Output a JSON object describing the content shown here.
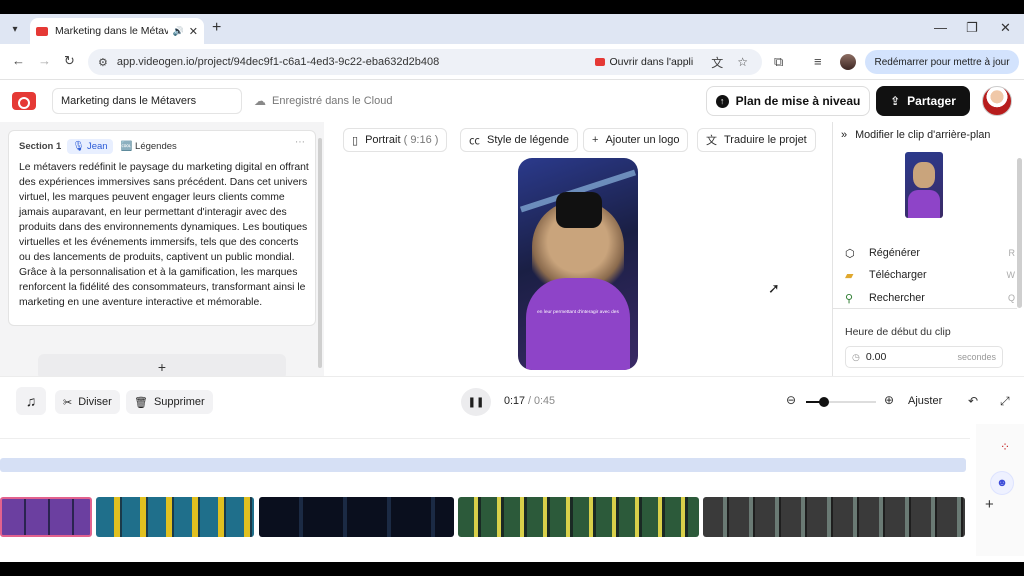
{
  "browser": {
    "tab_title": "Marketing dans le Métavers",
    "url": "app.videogen.io/project/94dec9f1-c6a1-4ed3-9c22-eba632d2b408",
    "open_in_app": "Ouvrir dans l'appli",
    "restart_label": "Redémarrer pour mettre à jour"
  },
  "header": {
    "project_name": "Marketing dans le Métavers",
    "save_status": "Enregistré dans le Cloud",
    "upgrade_label": "Plan de mise à niveau",
    "share_label": "Partager"
  },
  "script": {
    "section_label": "Section 1",
    "voice": "Jean",
    "captions": "Légendes",
    "text": "Le métavers redéfinit le paysage du marketing digital en offrant des expériences immersives sans précédent. Dans cet univers virtuel, les marques peuvent engager leurs clients comme jamais auparavant, en leur permettant d'interagir avec des produits dans des environnements dynamiques. Les boutiques virtuelles et les événements immersifs, tels que des concerts ou des lancements de produits, captivent un public mondial. Grâce à la personnalisation et à la gamification, les marques renforcent la fidélité des consommateurs, transformant ainsi le marketing en une aventure interactive et mémorable.",
    "add_label": "+"
  },
  "toolbar": {
    "portrait": "Portrait",
    "ratio": "( 9:16 )",
    "caption_style": "Style de légende",
    "add_logo": "Ajouter un logo",
    "translate": "Traduire le projet"
  },
  "preview": {
    "caption": "en leur permettant d'interagir avec des"
  },
  "right_panel": {
    "title": "Modifier le clip d'arrière-plan",
    "actions": [
      {
        "label": "Régénérer",
        "key": "R",
        "icon": "cube-icon"
      },
      {
        "label": "Télécharger",
        "key": "W",
        "icon": "folder-icon"
      },
      {
        "label": "Rechercher",
        "key": "Q",
        "icon": "search-icon"
      }
    ],
    "start_time_label": "Heure de début du clip",
    "start_time_value": "0.00",
    "start_time_unit": "secondes"
  },
  "controls": {
    "split": "Diviser",
    "delete": "Supprimer",
    "current_time": "0:17",
    "duration": " / 0:45",
    "zoom_level": 0.25,
    "fit": "Ajuster"
  },
  "colors": {
    "brand": "#e53935",
    "caption_track": "#d6e0f5",
    "selected_clip_border": "#e2628e"
  }
}
